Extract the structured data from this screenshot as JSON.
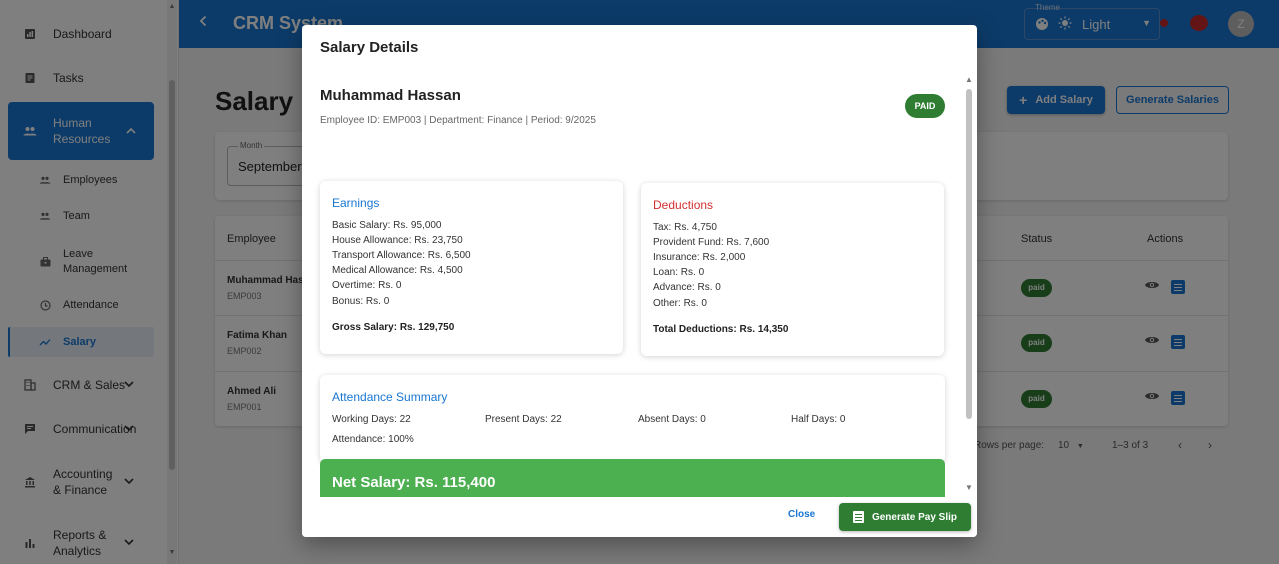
{
  "sidebar": {
    "items": [
      {
        "label": "Dashboard",
        "icon": "dashboard-icon"
      },
      {
        "label": "Tasks",
        "icon": "tasks-icon"
      },
      {
        "label": "Human Resources",
        "icon": "people-icon"
      },
      {
        "label": "CRM & Sales",
        "icon": "business-icon"
      },
      {
        "label": "Communication",
        "icon": "chat-icon"
      },
      {
        "label": "Accounting & Finance",
        "icon": "bank-icon"
      },
      {
        "label": "Reports & Analytics",
        "icon": "bar-chart-icon"
      }
    ],
    "sub_items": [
      {
        "label": "Employees"
      },
      {
        "label": "Team"
      },
      {
        "label": "Leave Management"
      },
      {
        "label": "Attendance"
      },
      {
        "label": "Salary"
      }
    ]
  },
  "appbar": {
    "title": "CRM System",
    "theme_value": "Light",
    "avatar_initial": "Z",
    "accent": "#1976d2"
  },
  "page": {
    "title": "Salary M",
    "add_button": "Add Salary",
    "generate_button": "Generate Salaries",
    "month_label": "Month",
    "month_value": "September",
    "columns": {
      "employee": "Employee",
      "status": "Status",
      "actions": "Actions"
    },
    "rows": [
      {
        "name": "Muhammad Has",
        "id": "EMP003",
        "status": "paid"
      },
      {
        "name": "Fatima Khan",
        "id": "EMP002",
        "status": "paid"
      },
      {
        "name": "Ahmed Ali",
        "id": "EMP001",
        "status": "paid"
      }
    ],
    "pager": {
      "rows_label": "Rows per page:",
      "rows_value": "10",
      "range": "1–3 of 3"
    }
  },
  "dialog": {
    "title": "Salary Details",
    "employee_name": "Muhammad Hassan",
    "employee_meta": "Employee ID: EMP003 | Department: Finance | Period: 9/2025",
    "status_badge": "PAID",
    "earnings": {
      "heading": "Earnings",
      "lines": [
        "Basic Salary: Rs. 95,000",
        "House Allowance: Rs. 23,750",
        "Transport Allowance: Rs. 6,500",
        "Medical Allowance: Rs. 4,500",
        "Overtime: Rs. 0",
        "Bonus: Rs. 0"
      ],
      "total": "Gross Salary: Rs. 129,750"
    },
    "deductions": {
      "heading": "Deductions",
      "lines": [
        "Tax: Rs. 4,750",
        "Provident Fund: Rs. 7,600",
        "Insurance: Rs. 2,000",
        "Loan: Rs. 0",
        "Advance: Rs. 0",
        "Other: Rs. 0"
      ],
      "total": "Total Deductions: Rs. 14,350"
    },
    "attendance": {
      "heading": "Attendance Summary",
      "working_days": "Working Days: 22",
      "present_days": "Present Days: 22",
      "absent_days": "Absent Days: 0",
      "half_days": "Half Days: 0",
      "attendance": "Attendance: 100%"
    },
    "net_salary": "Net Salary: Rs. 115,400",
    "close_button": "Close",
    "payslip_button": "Generate Pay Slip",
    "colors": {
      "earnings": "#1976d2",
      "deductions": "#d32f2f",
      "net": "#4caf50",
      "paid": "#2e7d32"
    }
  }
}
